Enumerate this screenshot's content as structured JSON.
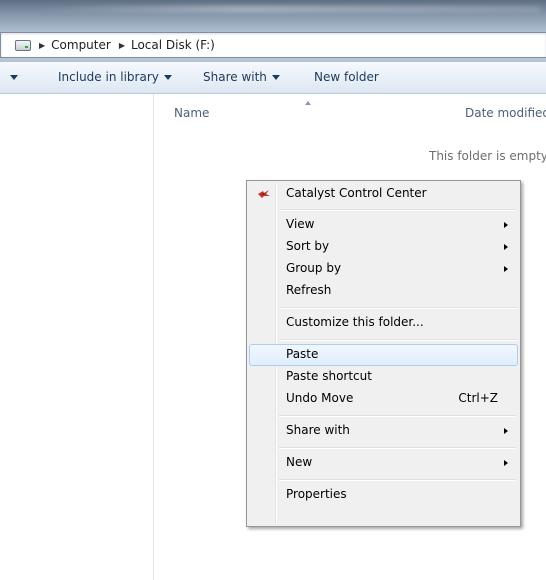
{
  "address_bar": {
    "breadcrumbs": [
      "Computer",
      "Local Disk (F:)"
    ],
    "drive_icon": "hard-drive-icon"
  },
  "toolbar": {
    "include_in_library": "Include in library",
    "share_with": "Share with",
    "new_folder": "New folder"
  },
  "columns": {
    "name": "Name",
    "date_modified": "Date modified"
  },
  "content": {
    "empty_message": "This folder is empty."
  },
  "context_menu": {
    "catalyst": "Catalyst Control Center",
    "view": "View",
    "sort_by": "Sort by",
    "group_by": "Group by",
    "refresh": "Refresh",
    "customize": "Customize this folder...",
    "paste": "Paste",
    "paste_shortcut": "Paste shortcut",
    "undo_move": "Undo Move",
    "undo_move_shortcut": "Ctrl+Z",
    "share_with": "Share with",
    "new": "New",
    "properties": "Properties"
  },
  "colors": {
    "toolbar_text": "#1e395b",
    "menu_bg": "#f0f0f0",
    "menu_hover_border": "#a8d0f5"
  }
}
